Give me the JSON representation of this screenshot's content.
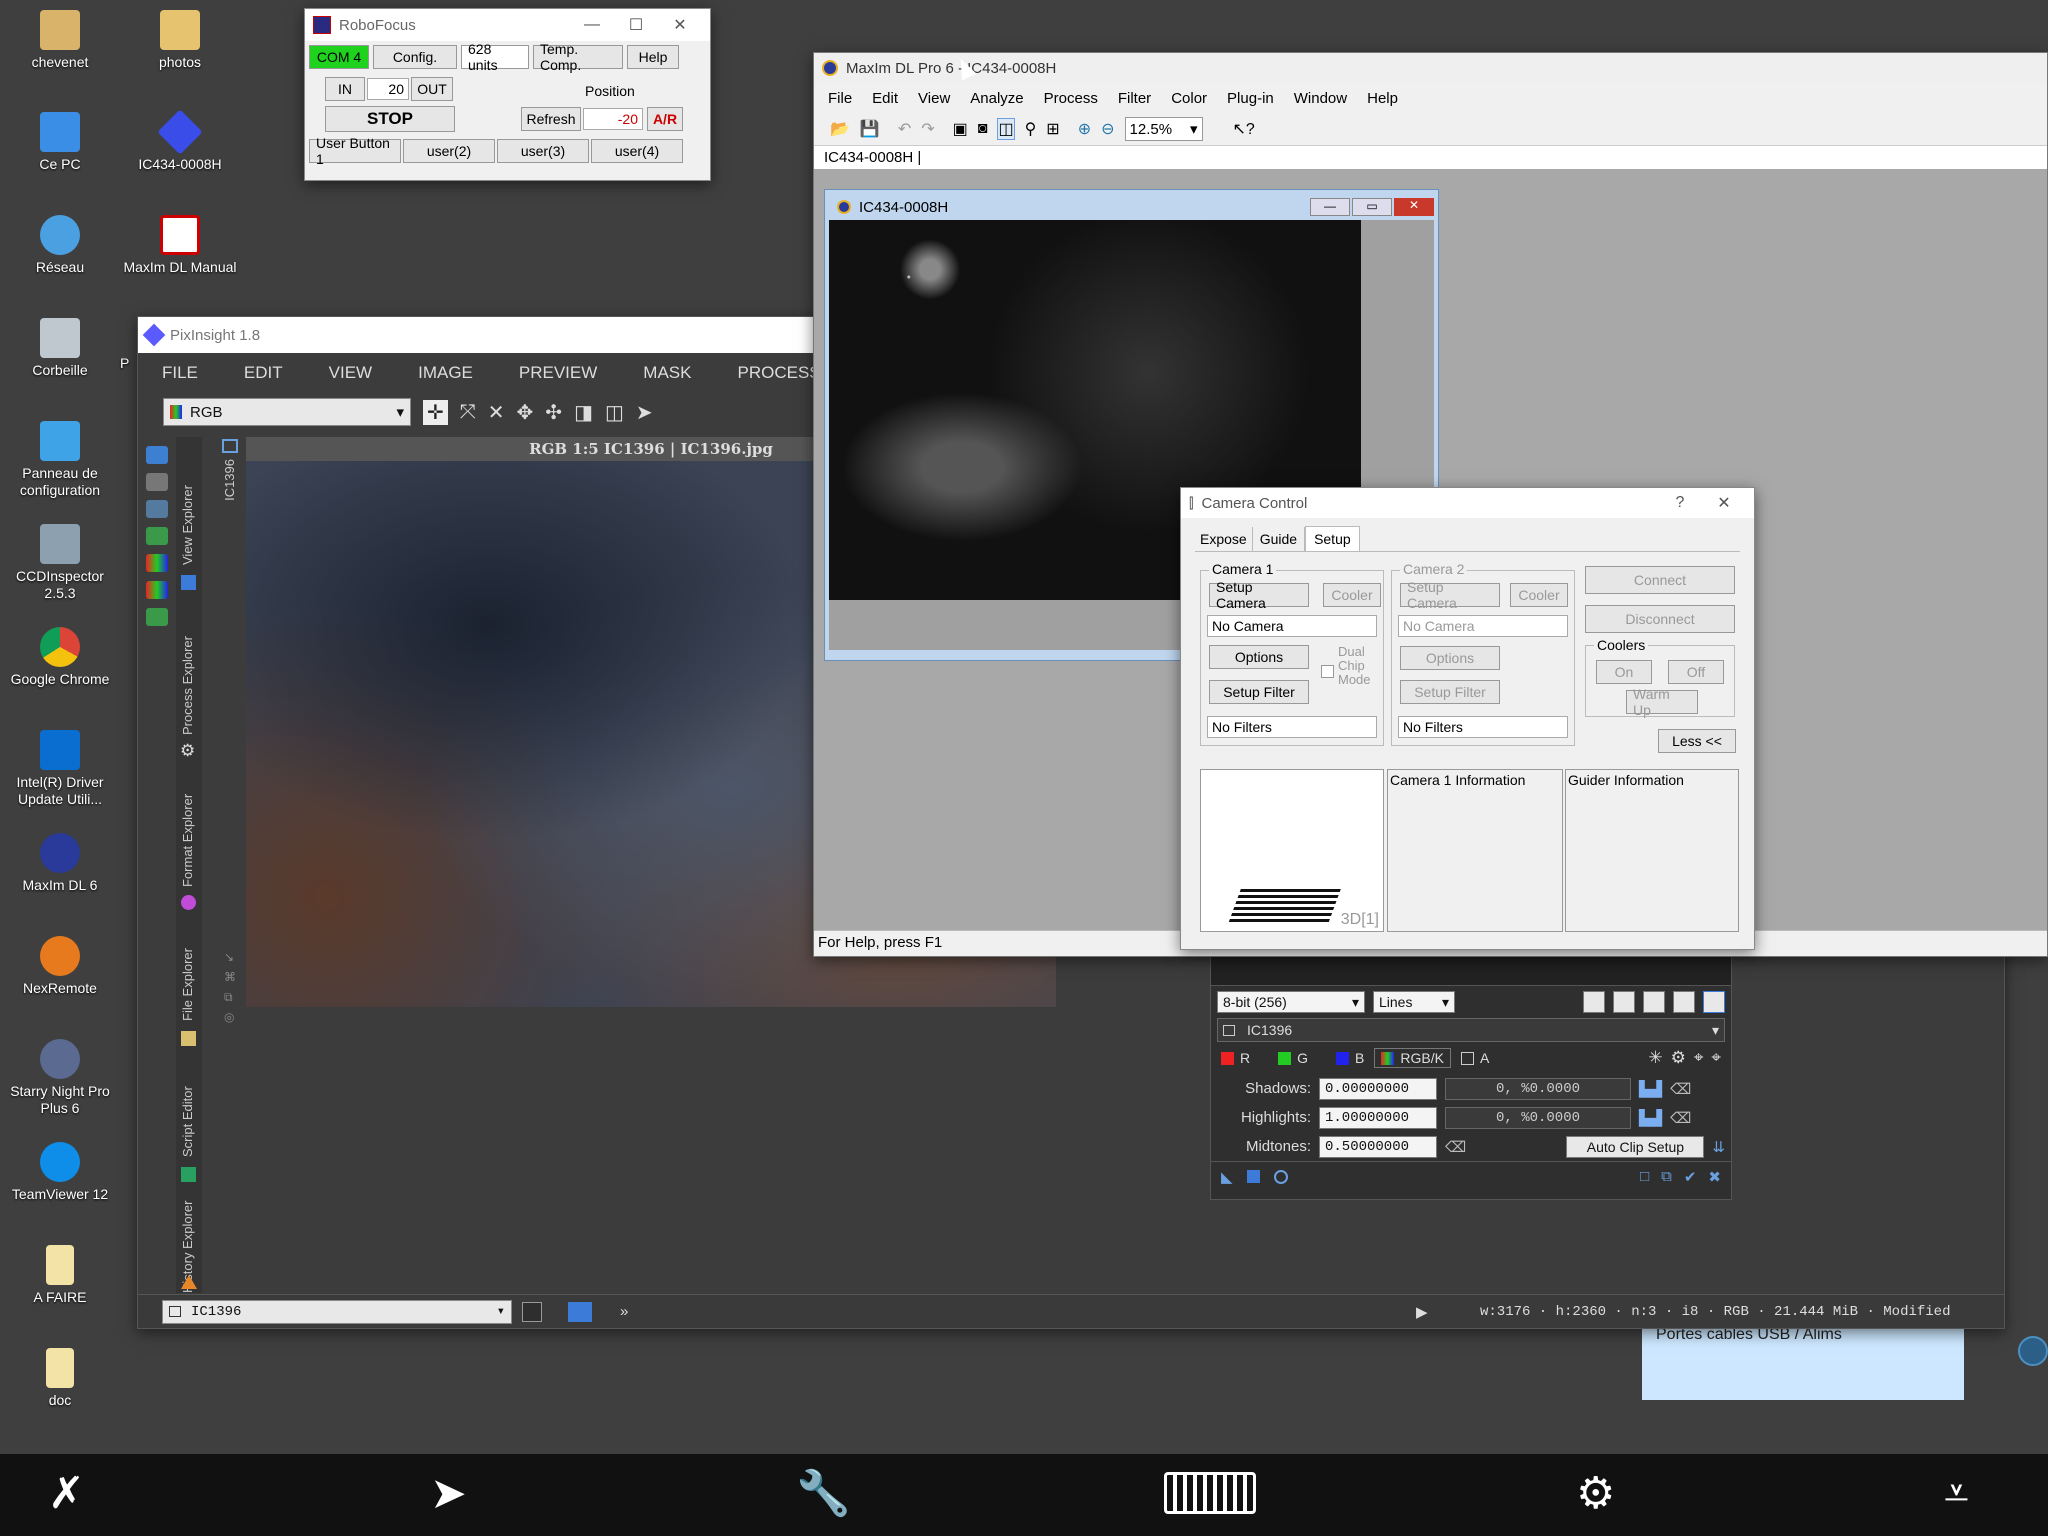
{
  "desktop": {
    "icons": [
      {
        "label": "chevenet",
        "icon": "folder-user-icon"
      },
      {
        "label": "photos",
        "icon": "folder-icon"
      },
      {
        "label": "Ce PC",
        "icon": "computer-icon"
      },
      {
        "label": "IC434-0008H",
        "icon": "maxim-image-icon"
      },
      {
        "label": "Réseau",
        "icon": "network-icon"
      },
      {
        "label": "MaxIm DL Manual",
        "icon": "pdf-icon"
      },
      {
        "label": "Corbeille",
        "icon": "recycle-bin-icon"
      },
      {
        "label": "Panneau de configuration",
        "icon": "control-panel-icon"
      },
      {
        "label": "CCDInspector 2.5.3",
        "icon": "ccdinspector-icon"
      },
      {
        "label": "Google Chrome",
        "icon": "chrome-icon"
      },
      {
        "label": "Intel(R) Driver Update Utili...",
        "icon": "intel-icon"
      },
      {
        "label": "MaxIm DL 6",
        "icon": "maxim-dl-icon"
      },
      {
        "label": "NexRemote",
        "icon": "nexremote-icon"
      },
      {
        "label": "Starry Night Pro Plus 6",
        "icon": "starry-night-icon"
      },
      {
        "label": "TeamViewer 12",
        "icon": "teamviewer-icon"
      },
      {
        "label": "A FAIRE",
        "icon": "document-icon"
      },
      {
        "label": "doc",
        "icon": "document-icon"
      },
      {
        "label": "P",
        "icon": "partial-icon"
      }
    ],
    "sticky_note": "Portes cables USB / Alims"
  },
  "robofocus": {
    "title": "RoboFocus",
    "com": "COM 4",
    "config": "Config.",
    "units": "628 units",
    "temp_comp": "Temp. Comp.",
    "help": "Help",
    "in": "IN",
    "step": "20",
    "out": "OUT",
    "position_label": "Position",
    "stop": "STOP",
    "refresh": "Refresh",
    "position_value": "-20",
    "ar": "A/R",
    "user_buttons": [
      "User Button 1",
      "user(2)",
      "user(3)",
      "user(4)"
    ]
  },
  "pixinsight": {
    "title": "PixInsight 1.8",
    "menu": [
      "FILE",
      "EDIT",
      "VIEW",
      "IMAGE",
      "PREVIEW",
      "MASK",
      "PROCESS"
    ],
    "mode": "RGB",
    "image_title": "RGB 1:5 IC1396 | IC1396.jpg",
    "view_tab": "IC1396",
    "side_tabs": [
      "View Explorer",
      "Process Explorer",
      "Format Explorer",
      "File Explorer",
      "Script Editor",
      "History Explorer"
    ],
    "status_view": "IC1396",
    "status_info": "w:3176 · h:2360 · n:3 · i8 · RGB · 21.444 MiB · Modified",
    "more": "»"
  },
  "maxim": {
    "title": "MaxIm DL Pro 6 - IC434-0008H",
    "menu": [
      "File",
      "Edit",
      "View",
      "Analyze",
      "Process",
      "Filter",
      "Color",
      "Plug-in",
      "Window",
      "Help"
    ],
    "zoom": "12.5%",
    "doc_tab": "IC434-0008H",
    "image_window_title": "IC434-0008H",
    "status": "For Help, press F1"
  },
  "camera": {
    "title": "Camera Control",
    "help": "?",
    "tabs": [
      "Expose",
      "Guide",
      "Setup"
    ],
    "cam1": {
      "label": "Camera 1",
      "setup": "Setup Camera",
      "cooler": "Cooler",
      "camera": "No Camera",
      "options": "Options",
      "dual": "Dual Chip Mode",
      "setup_filter": "Setup Filter",
      "filters": "No Filters"
    },
    "cam2": {
      "label": "Camera 2",
      "setup": "Setup Camera",
      "cooler": "Cooler",
      "camera": "No Camera",
      "options": "Options",
      "setup_filter": "Setup Filter",
      "filters": "No Filters"
    },
    "connect": "Connect",
    "disconnect": "Disconnect",
    "coolers": "Coolers",
    "on": "On",
    "off": "Off",
    "warmup": "Warm Up",
    "less": "Less <<",
    "info1": "Camera 1 Information",
    "info2": "Guider Information",
    "tag3d": "3D[1]"
  },
  "stf": {
    "depth": "8-bit (256)",
    "mode": "Lines",
    "view": "IC1396",
    "channels": [
      "R",
      "G",
      "B",
      "RGB/K",
      "A"
    ],
    "shadows_label": "Shadows:",
    "shadows": "0.00000000",
    "shadows_stat": "0, %0.0000",
    "highlights_label": "Highlights:",
    "highlights": "1.00000000",
    "highlights_stat": "0, %0.0000",
    "midtones_label": "Midtones:",
    "midtones": "0.50000000",
    "autoclip": "Auto Clip Setup"
  },
  "colors": {
    "com_green": "#1ed21e",
    "pix_bg": "#3c3c3c",
    "taskbar": "#111111",
    "sticky": "#cce7ff"
  }
}
